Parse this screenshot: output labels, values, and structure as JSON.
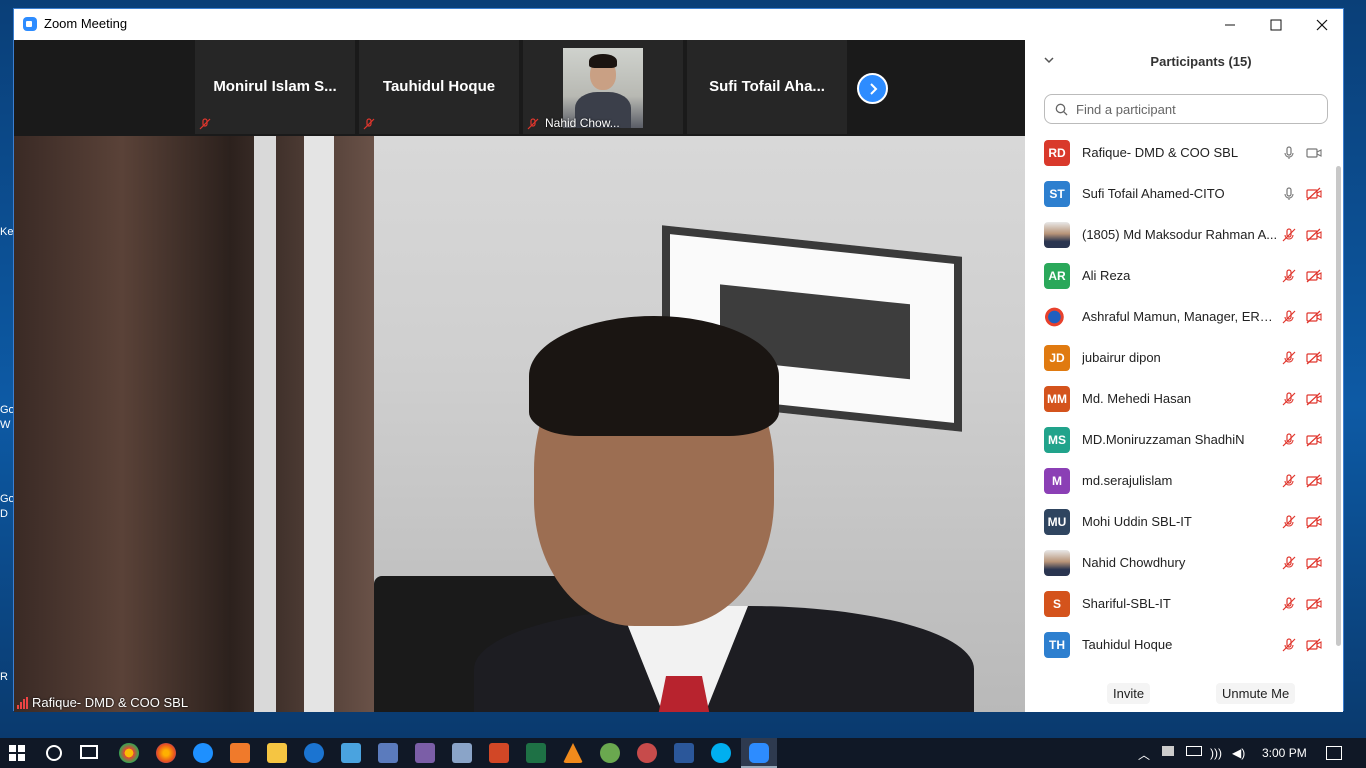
{
  "window": {
    "title": "Zoom Meeting",
    "minimize_label": "—",
    "maximize_label": "☐",
    "close_label": "✕"
  },
  "gallery_strip": {
    "tiles": [
      {
        "name": "Monirul  Islam  S...",
        "muted": true,
        "has_video": false
      },
      {
        "name": "Tauhidul Hoque",
        "muted": true,
        "has_video": false
      },
      {
        "name": "Nahid Chow...",
        "muted": true,
        "has_video": true
      },
      {
        "name": "Sufi Tofail Aha...",
        "muted": false,
        "has_video": false
      }
    ],
    "next_label": "›"
  },
  "main_video": {
    "speaker": "Rafique- DMD & COO SBL"
  },
  "desktop_labels": [
    "Ke",
    "Go",
    "W",
    "Go",
    "D",
    "R"
  ],
  "participants": {
    "title": "Participants (15)",
    "collapse_icon": "chevron-down-icon",
    "search_placeholder": "Find a participant",
    "list": [
      {
        "initials": "RD",
        "name": "Rafique- DMD & COO SBL",
        "color": "#d9392b",
        "mic": "on",
        "video": "on"
      },
      {
        "initials": "ST",
        "name": "Sufi Tofail Ahamed-CITO",
        "color": "#2d7fcf",
        "mic": "on",
        "video": "off"
      },
      {
        "initials": "",
        "name": "(1805) Md Maksodur Rahman A...",
        "color": "#ffffff",
        "mic": "off",
        "video": "off",
        "photo": true
      },
      {
        "initials": "AR",
        "name": "Ali Reza",
        "color": "#2aa85a",
        "mic": "off",
        "video": "off"
      },
      {
        "initials": "",
        "name": "Ashraful Mamun, Manager, ERA...",
        "color": "#ffffff",
        "mic": "off",
        "video": "off",
        "logo": true
      },
      {
        "initials": "JD",
        "name": "jubairur dipon",
        "color": "#e07a10",
        "mic": "off",
        "video": "off"
      },
      {
        "initials": "MM",
        "name": "Md. Mehedi Hasan",
        "color": "#d4531c",
        "mic": "off",
        "video": "off"
      },
      {
        "initials": "MS",
        "name": "MD.Moniruzzaman ShadhiN",
        "color": "#21a38b",
        "mic": "off",
        "video": "off"
      },
      {
        "initials": "M",
        "name": "md.serajulislam",
        "color": "#8b3fb5",
        "mic": "off",
        "video": "off"
      },
      {
        "initials": "MU",
        "name": "Mohi Uddin SBL-IT",
        "color": "#2f4560",
        "mic": "off",
        "video": "off"
      },
      {
        "initials": "",
        "name": "Nahid Chowdhury",
        "color": "#ffffff",
        "mic": "off",
        "video": "off",
        "photo": true
      },
      {
        "initials": "S",
        "name": "Shariful-SBL-IT",
        "color": "#d4531c",
        "mic": "off",
        "video": "off"
      },
      {
        "initials": "TH",
        "name": "Tauhidul Hoque",
        "color": "#2d7fcf",
        "mic": "off",
        "video": "off"
      }
    ],
    "invite_label": "Invite",
    "unmute_label": "Unmute Me"
  },
  "taskbar": {
    "clock": "3:00 PM"
  },
  "colors": {
    "zoom_blue": "#2d8cff",
    "muted_red": "#e0362d"
  }
}
